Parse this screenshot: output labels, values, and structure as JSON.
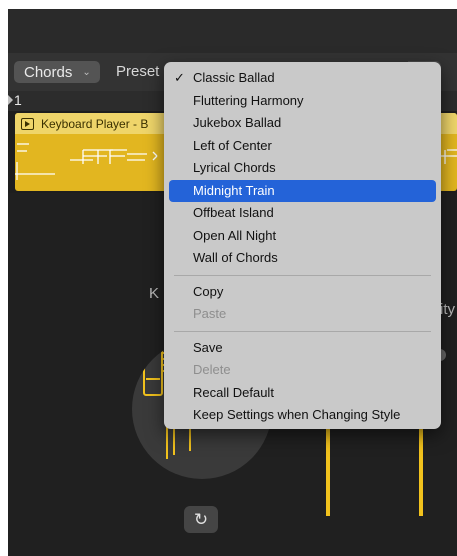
{
  "controlbar": {
    "chords_label": "Chords",
    "chords_chevron": "⌄",
    "preset_label": "Preset"
  },
  "ruler": {
    "bar_number": "1"
  },
  "region": {
    "title": "Keyboard Player - B"
  },
  "editor": {
    "left_partial_label": "K",
    "right_partial_label": "ity",
    "refresh_glyph": "↻"
  },
  "preset_menu": {
    "checkmark": "✓",
    "presets": [
      {
        "label": "Classic Ballad",
        "checked": true,
        "selected": false
      },
      {
        "label": "Fluttering Harmony",
        "checked": false,
        "selected": false
      },
      {
        "label": "Jukebox Ballad",
        "checked": false,
        "selected": false
      },
      {
        "label": "Left of Center",
        "checked": false,
        "selected": false
      },
      {
        "label": "Lyrical Chords",
        "checked": false,
        "selected": false
      },
      {
        "label": "Midnight Train",
        "checked": false,
        "selected": true
      },
      {
        "label": "Offbeat Island",
        "checked": false,
        "selected": false
      },
      {
        "label": "Open All Night",
        "checked": false,
        "selected": false
      },
      {
        "label": "Wall of Chords",
        "checked": false,
        "selected": false
      }
    ],
    "edit_actions": [
      {
        "label": "Copy",
        "enabled": true
      },
      {
        "label": "Paste",
        "enabled": false
      }
    ],
    "file_actions": [
      {
        "label": "Save",
        "enabled": true
      },
      {
        "label": "Delete",
        "enabled": false
      },
      {
        "label": "Recall Default",
        "enabled": true
      },
      {
        "label": "Keep Settings when Changing Style",
        "enabled": true
      }
    ]
  },
  "colors": {
    "accent_selection": "#2463d8",
    "region_yellow": "#e2b620",
    "instrument_yellow": "#f2c21d"
  }
}
